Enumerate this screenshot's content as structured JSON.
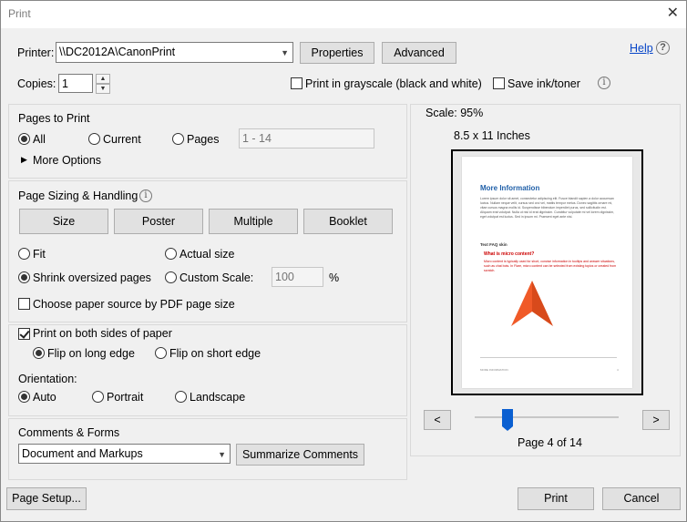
{
  "window": {
    "title": "Print",
    "close_glyph": "✕"
  },
  "printer": {
    "label": "Printer:",
    "selected": "\\\\DC2012A\\CanonPrint",
    "properties_label": "Properties",
    "advanced_label": "Advanced",
    "help_label": "Help"
  },
  "copies": {
    "label": "Copies:",
    "value": "1",
    "grayscale_label": "Print in grayscale (black and white)",
    "grayscale_checked": false,
    "save_ink_label": "Save ink/toner",
    "save_ink_checked": false
  },
  "pages_to_print": {
    "heading": "Pages to Print",
    "all_label": "All",
    "current_label": "Current",
    "pages_label": "Pages",
    "pages_range_placeholder": "1 - 14",
    "selected": "All",
    "more_options_label": "More Options"
  },
  "sizing": {
    "heading": "Page Sizing & Handling",
    "size_label": "Size",
    "poster_label": "Poster",
    "multiple_label": "Multiple",
    "booklet_label": "Booklet",
    "fit_label": "Fit",
    "actual_size_label": "Actual size",
    "shrink_label": "Shrink oversized pages",
    "custom_scale_label": "Custom Scale:",
    "custom_scale_value": "100",
    "percent_label": "%",
    "selected": "Shrink oversized pages",
    "paper_source_label": "Choose paper source by PDF page size",
    "paper_source_checked": false
  },
  "duplex": {
    "both_sides_label": "Print on both sides of paper",
    "both_sides_checked": true,
    "long_edge_label": "Flip on long edge",
    "short_edge_label": "Flip on short edge",
    "selected": "Flip on long edge"
  },
  "orientation": {
    "label": "Orientation:",
    "auto_label": "Auto",
    "portrait_label": "Portrait",
    "landscape_label": "Landscape",
    "selected": "Auto"
  },
  "comments": {
    "heading": "Comments & Forms",
    "selected": "Document and Markups",
    "summarize_label": "Summarize Comments"
  },
  "preview": {
    "scale_text": "Scale:  95%",
    "paper_size": "8.5 x 11 Inches",
    "page_counter": "Page 4 of 14",
    "current_page": 4,
    "total_pages": 14,
    "prev_glyph": "<",
    "next_glyph": ">",
    "doc": {
      "title": "More Information",
      "body": "Lorem ipsum dolor sit amet, consectetur adipiscing elit. Fusce blandit sapien a dolor accumsan luctus. Nullam neque velit, cursus sed orci vel, mattis tempor metus. Donec sagittis ornare mi, vitae cursus magna mollis id. Suspendisse bibendum imperdiet purus, sed sollicitudin est. Aliquam erat volutpat. Nulla ut nisl id erat dignissim. Curabitur vulputate mi vel lorem dignissim, eget volutpat est luctus. Sed in ipsum mi. Praesent eget ante nisi.",
      "subheading": "Text FAQ skin",
      "red_heading": "What is micro content?",
      "red_body": "Micro content is typically used for short, concise information in tooltips and answer situations, such as chat bots. In Flare, micro content can be selected from existing topics or created from scratch.",
      "footer_left": "MORE INFORMATION",
      "footer_right": "4",
      "accent_color": "#f05a28"
    }
  },
  "footer": {
    "page_setup_label": "Page Setup...",
    "print_label": "Print",
    "cancel_label": "Cancel"
  }
}
